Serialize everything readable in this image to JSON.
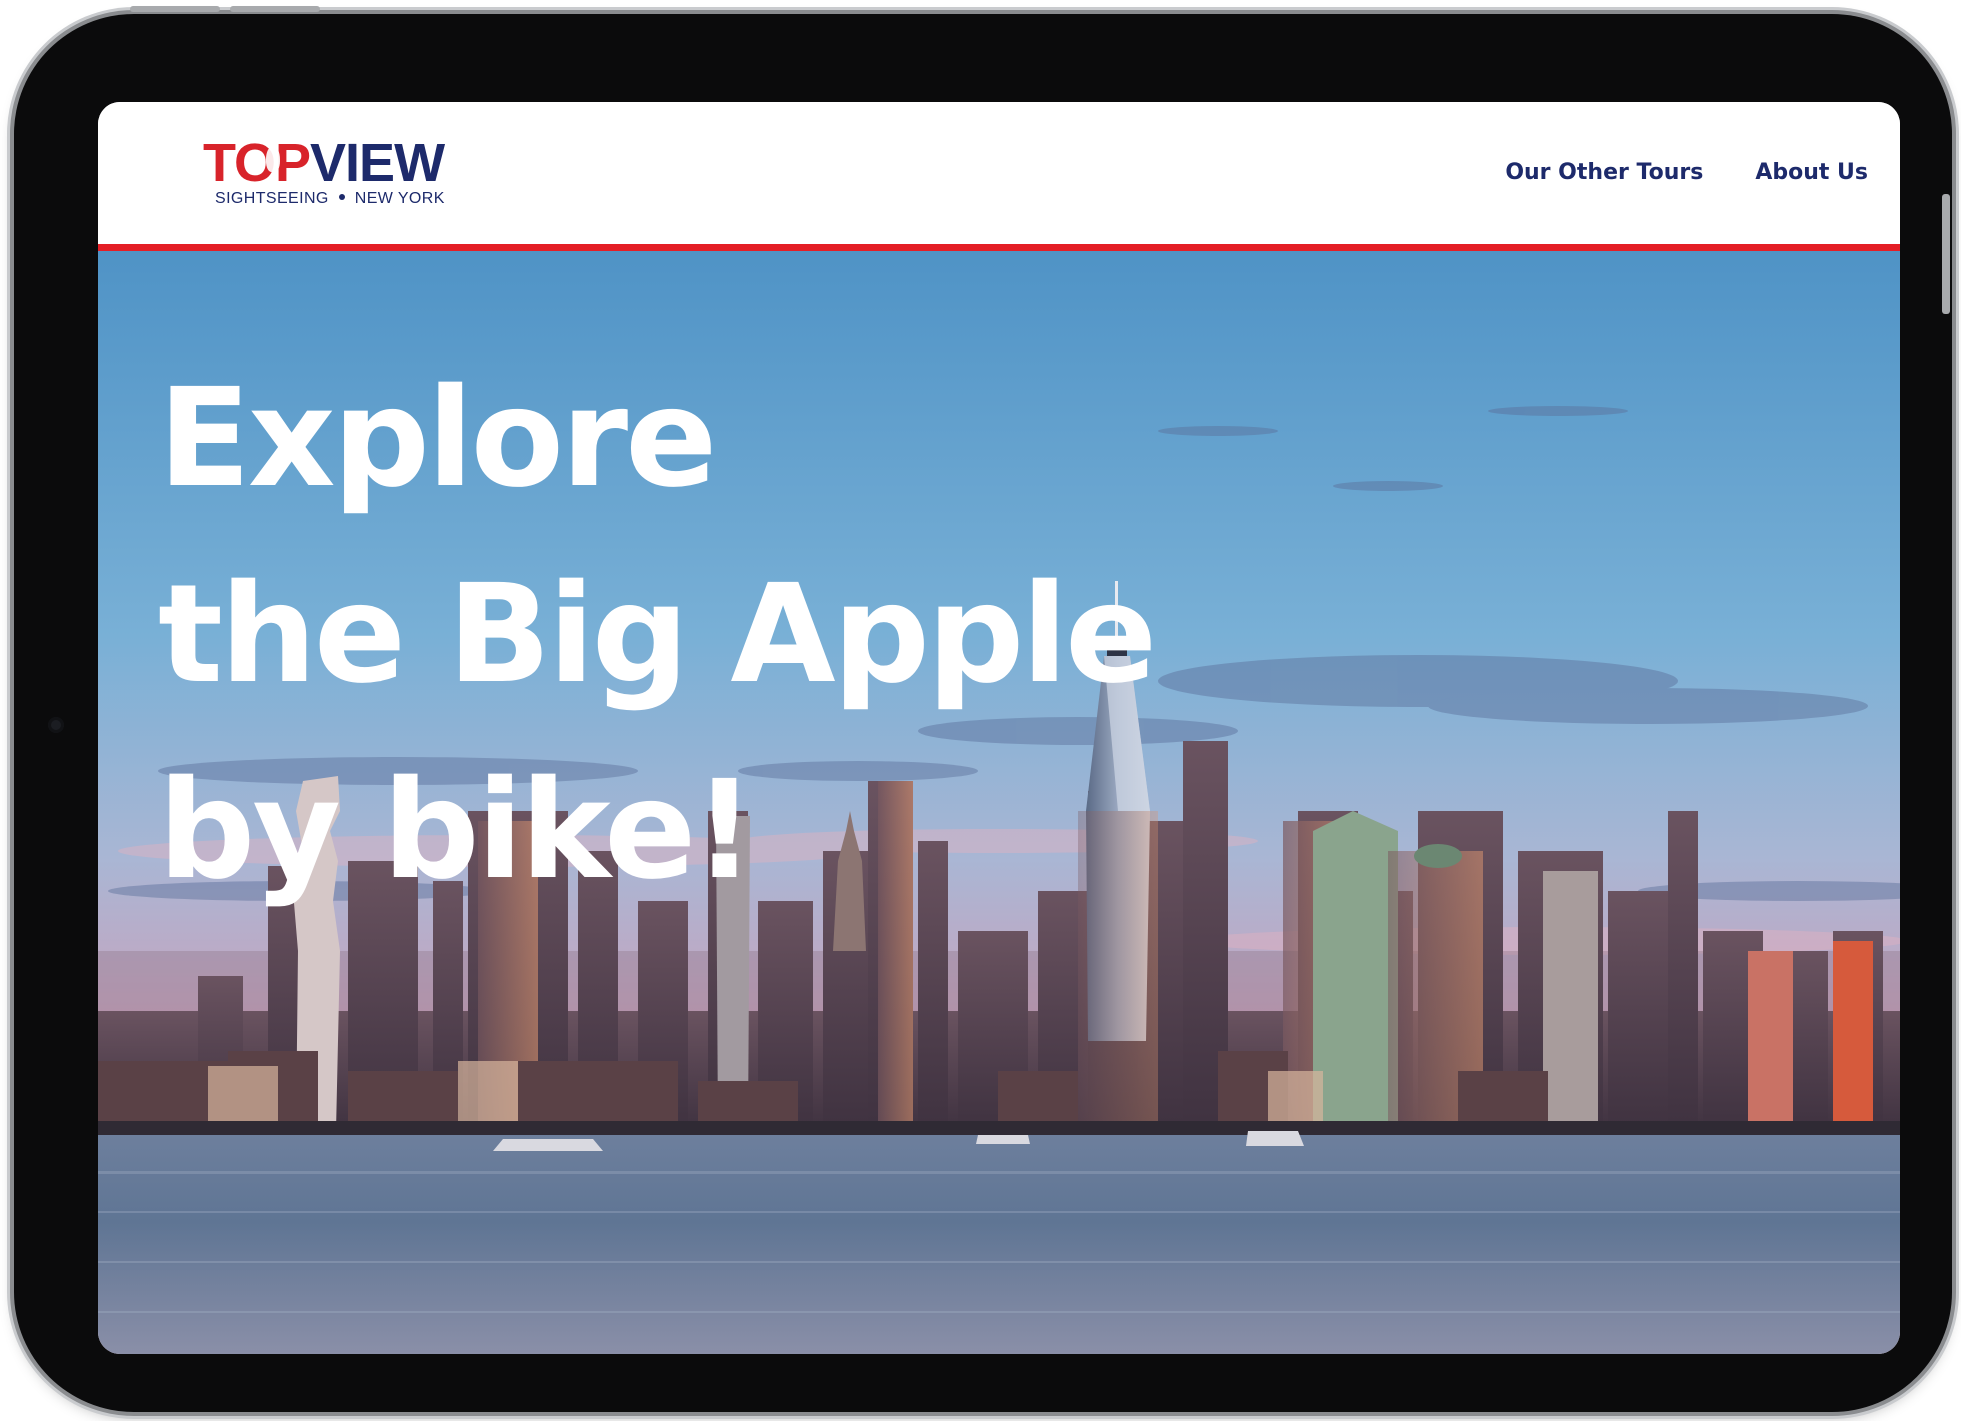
{
  "brand": {
    "name_part1": "TOP",
    "name_part2": "VIEW",
    "tagline_left": "SIGHTSEEING",
    "tagline_right": "NEW YORK",
    "red": "#e41e26",
    "navy": "#1d2a6b"
  },
  "nav": {
    "items": [
      {
        "label": "Our Other Tours"
      },
      {
        "label": "About Us"
      }
    ]
  },
  "hero": {
    "headline": [
      "Explore",
      "the Big Apple",
      "by bike!"
    ],
    "image_subject": "new-york-skyline-photo"
  }
}
